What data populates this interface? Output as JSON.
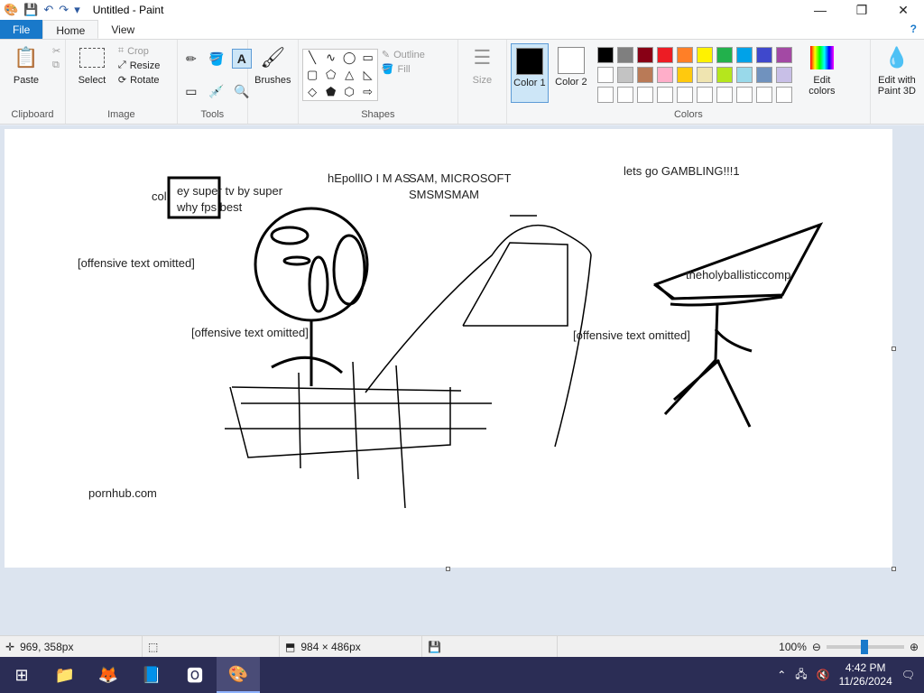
{
  "window": {
    "title": "Untitled - Paint"
  },
  "tabs": {
    "file": "File",
    "home": "Home",
    "view": "View"
  },
  "clipboard": {
    "paste": "Paste",
    "group": "Clipboard"
  },
  "image": {
    "select": "Select",
    "crop": "Crop",
    "resize": "Resize",
    "rotate": "Rotate",
    "group": "Image"
  },
  "tools": {
    "group": "Tools"
  },
  "brushes": {
    "label": "Brushes"
  },
  "shapes": {
    "outline": "Outline",
    "fill": "Fill",
    "group": "Shapes"
  },
  "size": {
    "label": "Size"
  },
  "colors": {
    "color1_label": "Color 1",
    "color2_label": "Color 2",
    "edit_colors": "Edit colors",
    "paint3d": "Edit with Paint 3D",
    "group": "Colors",
    "color1": "#000000",
    "color2": "#ffffff",
    "palette": [
      "#000000",
      "#7f7f7f",
      "#880015",
      "#ed1c24",
      "#ff7f27",
      "#fff200",
      "#22b14c",
      "#00a2e8",
      "#3f48cc",
      "#a349a4",
      "#ffffff",
      "#c3c3c3",
      "#b97a57",
      "#ffaec9",
      "#ffc90e",
      "#efe4b0",
      "#b5e61d",
      "#99d9ea",
      "#7092be",
      "#c8bfe7",
      "#ffffff",
      "#ffffff",
      "#ffffff",
      "#ffffff",
      "#ffffff",
      "#ffffff",
      "#ffffff",
      "#ffffff",
      "#ffffff",
      "#ffffff"
    ]
  },
  "canvas_texts": {
    "t1": "ey super tv by super",
    "t2": "why fps best",
    "t3": "hEpollIO I M AS",
    "t4": "SAM, MICROSOFT",
    "t5": "SMSMSMAM",
    "t6": "lets go GAMBLING!!!1",
    "t7": "[offensive text omitted]",
    "t8": "[offensive text omitted]",
    "t9": "theholyballisticcomp",
    "t10": "[offensive text omitted]",
    "t11": "pornhub.com",
    "t12": "col"
  },
  "status": {
    "cursor": "969, 358px",
    "dimensions": "984 × 486px",
    "zoom": "100%"
  },
  "taskbar": {
    "time": "4:42 PM",
    "date": "11/26/2024"
  }
}
